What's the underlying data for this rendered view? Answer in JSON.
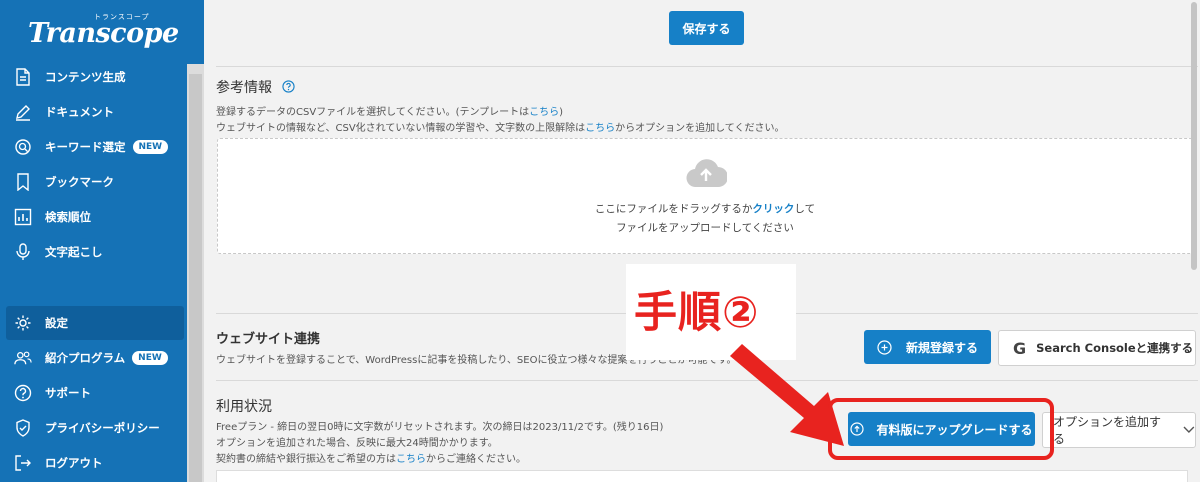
{
  "brand": {
    "logo_text": "Transcope",
    "logo_subtext": "トランスコープ"
  },
  "sidebar": {
    "items": [
      {
        "label": "コンテンツ生成",
        "icon": "document-icon"
      },
      {
        "label": "ドキュメント",
        "icon": "pencil-icon"
      },
      {
        "label": "キーワード選定",
        "icon": "search-icon",
        "badge": "NEW"
      },
      {
        "label": "ブックマーク",
        "icon": "bookmark-icon"
      },
      {
        "label": "検索順位",
        "icon": "chart-icon"
      },
      {
        "label": "文字起こし",
        "icon": "microphone-icon"
      },
      {
        "label": "設定",
        "icon": "gear-icon",
        "active": true
      },
      {
        "label": "紹介プログラム",
        "icon": "users-icon",
        "badge": "NEW"
      },
      {
        "label": "サポート",
        "icon": "help-icon"
      },
      {
        "label": "プライバシーポリシー",
        "icon": "shield-icon"
      },
      {
        "label": "ログアウト",
        "icon": "logout-icon"
      }
    ]
  },
  "main": {
    "save_button": "保存する",
    "reference": {
      "title": "参考情報",
      "line1_prefix": "登録するデータのCSVファイルを選択してください。(テンプレートは",
      "line1_link": "こちら",
      "line1_suffix": ")",
      "line2_prefix": "ウェブサイトの情報など、CSV化されていない情報の学習や、文字数の上限解除は",
      "line2_link": "こちら",
      "line2_suffix": "からオプションを追加してください。",
      "drop_prefix": "ここにファイルをドラッグするか",
      "drop_link": "クリック",
      "drop_suffix": "して",
      "drop_line2": "ファイルをアップロードしてください"
    },
    "annotation": "手順②",
    "website": {
      "title": "ウェブサイト連携",
      "desc": "ウェブサイトを登録することで、WordPressに記事を投稿したり、SEOに役立つ様々な提案を行うことが可能です。",
      "register_button": "新規登録する",
      "search_console_button": "Search Consoleと連携する"
    },
    "usage": {
      "title": "利用状況",
      "line1": "Freeプラン - 締日の翌日0時に文字数がリセットされます。次の締日は2023/11/2です。(残り16日)",
      "line2": "オプションを追加された場合、反映に最大24時間かかります。",
      "line3_prefix": "契約書の締結や銀行振込をご希望の方は",
      "line3_link": "こちら",
      "line3_suffix": "からご連絡ください。",
      "upgrade_button": "有料版にアップグレードする",
      "option_button": "オプションを追加する"
    }
  },
  "colors": {
    "sidebar": "#1572b6",
    "accent": "#1680c7",
    "annotation": "#e8231f"
  }
}
